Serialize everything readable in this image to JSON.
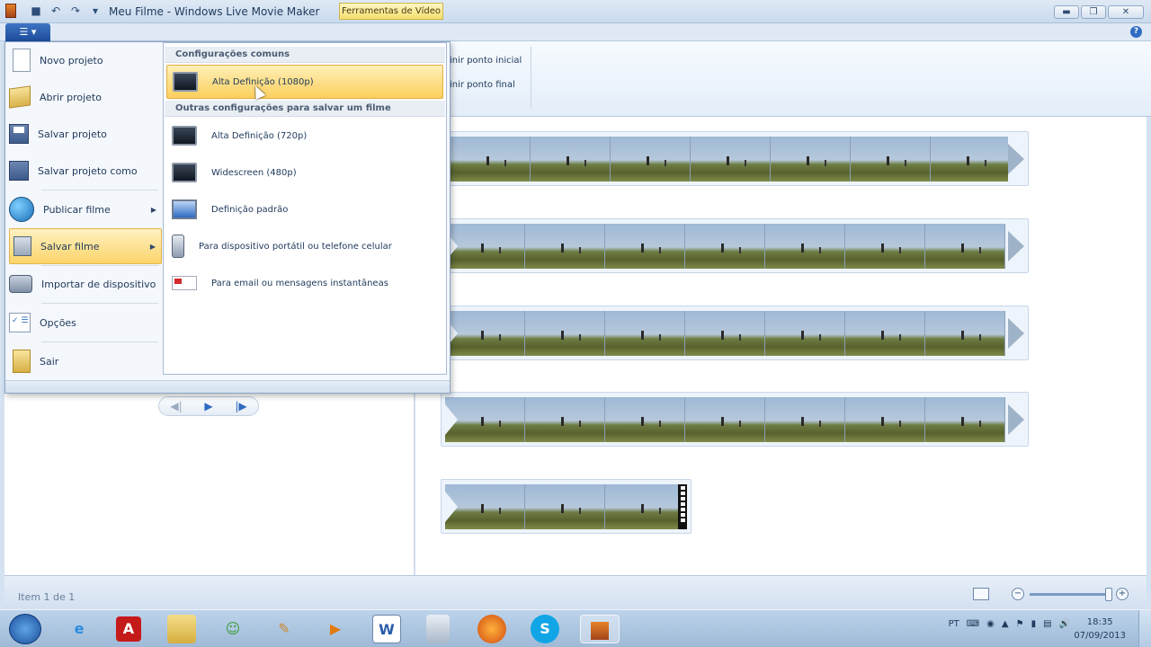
{
  "window": {
    "title": "Meu Filme - Windows Live Movie Maker",
    "context_tab": "Ferramentas de Vídeo",
    "minimize": "▬",
    "maximize": "❐",
    "close": "✕"
  },
  "ribbon": {
    "set_start": "inir ponto inicial",
    "set_end": "inir ponto final",
    "help": "?"
  },
  "file_menu": {
    "items": [
      {
        "label": "Novo projeto",
        "icon": "new-document-icon"
      },
      {
        "label": "Abrir projeto",
        "icon": "open-folder-icon"
      },
      {
        "label": "Salvar projeto",
        "icon": "save-icon"
      },
      {
        "label": "Salvar projeto como",
        "icon": "save-as-icon"
      },
      {
        "label": "Publicar filme",
        "icon": "globe-icon"
      },
      {
        "label": "Salvar filme",
        "icon": "save-movie-icon"
      },
      {
        "label": "Importar de dispositivo",
        "icon": "camera-icon"
      },
      {
        "label": "Opções",
        "icon": "options-icon"
      },
      {
        "label": "Sair",
        "icon": "exit-icon"
      }
    ],
    "submenu": {
      "header_common": "Configurações comuns",
      "header_other": "Outras configurações para salvar um filme",
      "items": [
        {
          "label": "Alta Definição (1080p)",
          "icon": "hd-tv-icon"
        },
        {
          "label": "Alta Definição (720p)",
          "icon": "hd-tv-icon"
        },
        {
          "label": "Widescreen (480p)",
          "icon": "widescreen-tv-icon"
        },
        {
          "label": "Definição padrão",
          "icon": "computer-monitor-icon"
        },
        {
          "label": "Para dispositivo portátil ou telefone celular",
          "icon": "mobile-phone-icon"
        },
        {
          "label": "Para email ou mensagens instantâneas",
          "icon": "email-icon"
        }
      ]
    }
  },
  "player": {
    "prev": "◀|",
    "play": "▶",
    "next": "|▶"
  },
  "status": {
    "item_count": "Item 1 de 1",
    "zoom_out": "−",
    "zoom_in": "+",
    "zoom_level": 1.0
  },
  "taskbar": {
    "icons": [
      "internet-explorer-icon",
      "adobe-reader-icon",
      "file-explorer-icon",
      "messenger-icon",
      "paint-icon",
      "media-player-icon",
      "word-icon",
      "calculator-icon",
      "firefox-icon",
      "skype-icon",
      "movie-maker-icon"
    ],
    "labels": {
      "adobe": "A",
      "word": "W"
    },
    "lang": "PT",
    "time": "18:35",
    "date": "07/09/2013"
  }
}
